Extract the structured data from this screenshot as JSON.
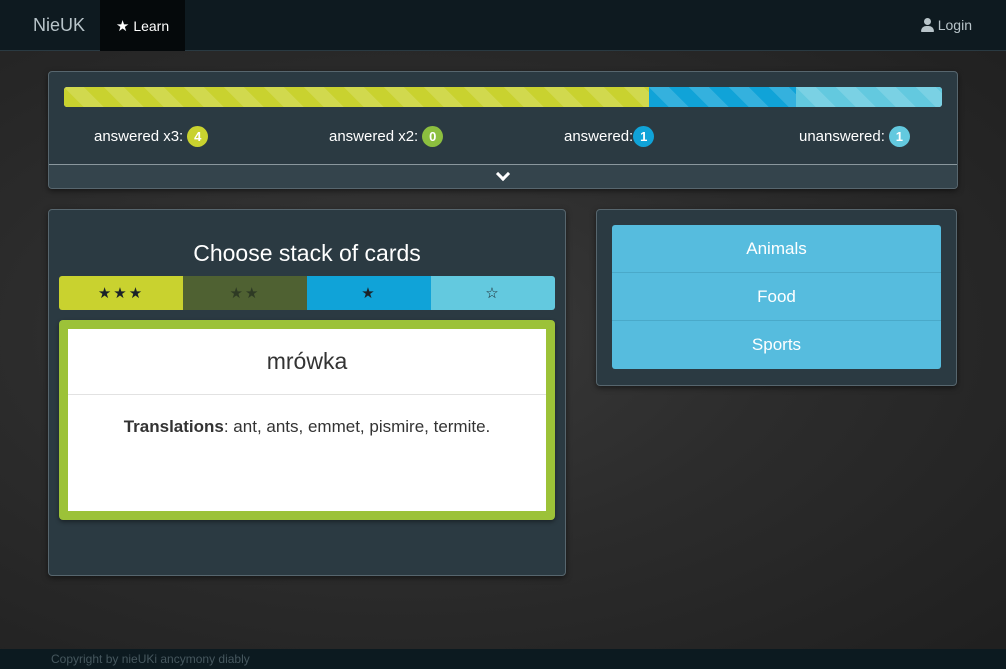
{
  "navbar": {
    "brand": "NieUK",
    "learn_label": "Learn",
    "login_label": "Login"
  },
  "progress": {
    "segments": {
      "answered_x3": 4,
      "answered_x2": 0,
      "answered": 1,
      "unanswered": 1
    },
    "stats": [
      {
        "label": "answered x3:",
        "count": "4"
      },
      {
        "label": "answered x2:",
        "count": "0"
      },
      {
        "label": "answered:",
        "count": "1"
      },
      {
        "label": "unanswered:",
        "count": "1"
      }
    ]
  },
  "cards": {
    "title": "Choose stack of cards",
    "tabs": [
      "★★★",
      "★★",
      "★",
      "☆"
    ],
    "word": "mrówka",
    "translations_label": "Translations",
    "translations_text": ": ant, ants, emmet, pismire, termite."
  },
  "categories": [
    "Animals",
    "Food",
    "Sports"
  ],
  "footer": {
    "text": "Copyright by nieUKi ancymony diably"
  },
  "colors": {
    "answered_x3": "#c9d22f",
    "answered_x2": "#8cbf3f",
    "answered": "#10a3d8",
    "unanswered": "#63c9df",
    "card_border": "#9cc238",
    "category_bg": "#56bcde"
  },
  "icons": {
    "learn": "star-icon",
    "login": "user-icon",
    "toggle": "chevron-down-icon"
  }
}
